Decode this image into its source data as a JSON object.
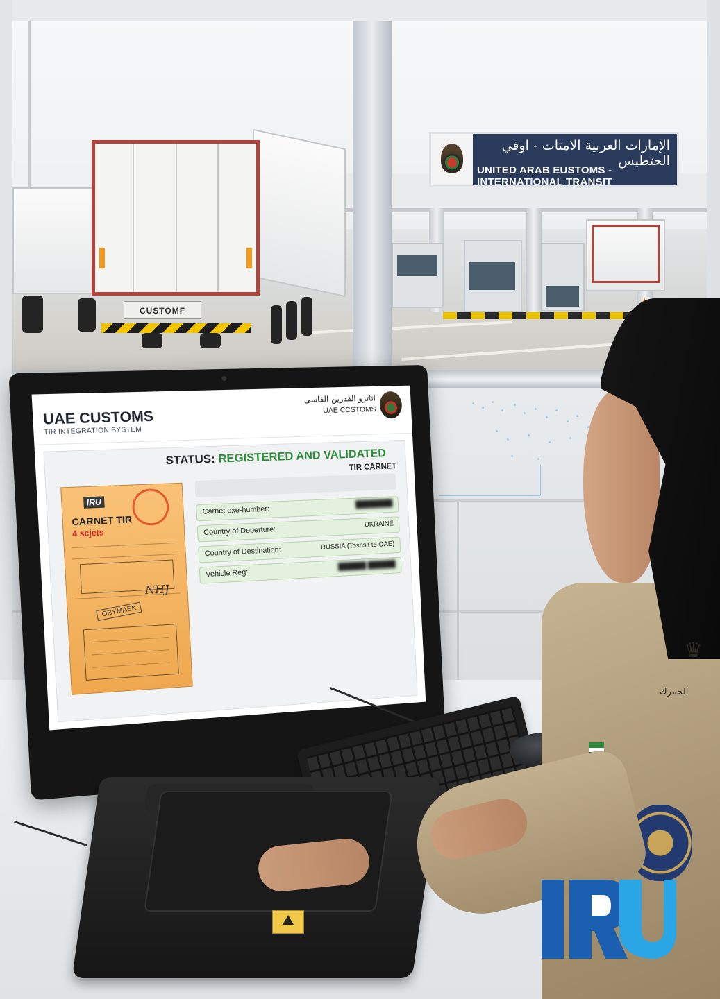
{
  "gate_sign": {
    "arabic": "الإمارات العربية الامتات - اوفي الحتطيس",
    "english": "UNITED ARAB EUSTOMS - INTERNATIONAL TRANSIT"
  },
  "truck": {
    "plate": "CUSTOMF"
  },
  "screen": {
    "title": "UAE CUSTOMS",
    "subtitle": "TIR INTEGRATION SYSTEM",
    "logo_arabic": "اتاتزو القدرين الفاسي",
    "logo_english": "UAE CCSTOMS",
    "status_prefix": "STATUS:",
    "status_value": "REGISTERED AND VALIDATED",
    "carnet_label": "TIR CARNET",
    "document": {
      "brand": "IRU",
      "title": "CARNET TIR",
      "sheets": "4 scjets",
      "stamp_text": "OBYMAEK"
    },
    "fields": [
      {
        "label": "Carnet oxe-humber:",
        "value": ""
      },
      {
        "label": "Country of Deperture:",
        "value": "UKRAINE"
      },
      {
        "label": "Country of Destination:",
        "value": "RUSSIA (Tosnsit te OAE)"
      },
      {
        "label": "Vehicle Reg:",
        "value": ""
      }
    ]
  },
  "uniform": {
    "shoulder_text": "الحمرك"
  },
  "colors": {
    "status_green": "#2d8a3c",
    "iru_dark_blue": "#1a5fb0",
    "iru_light_blue": "#2aa6e6",
    "sign_navy": "#2b3b5c",
    "document_orange": "#f4b463"
  },
  "icons": {
    "customs_emblem": "falcon-emblem-icon",
    "iru_logo": "iru-logo-icon"
  }
}
